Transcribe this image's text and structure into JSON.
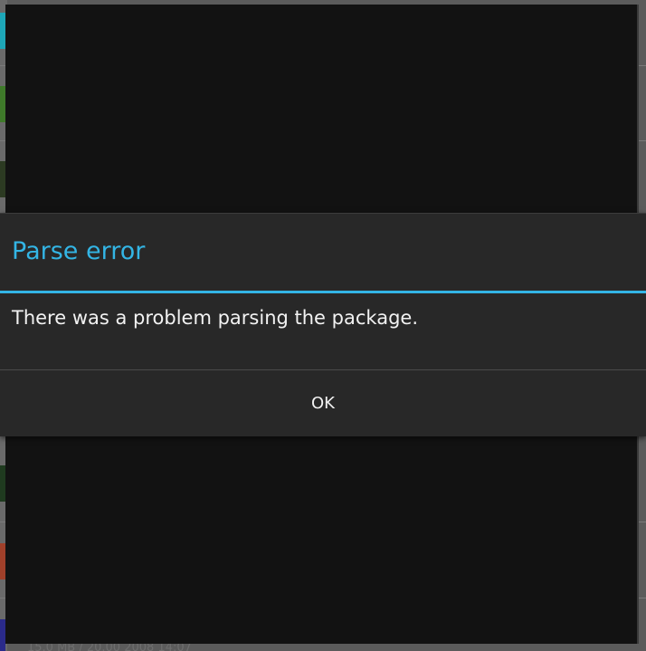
{
  "dialog": {
    "title": "Parse error",
    "message": "There was a problem parsing the package.",
    "ok_label": "OK"
  },
  "background": {
    "footer_text": "15.0 MB / 20.00 2008 14:07"
  },
  "colors": {
    "accent": "#33b5e5",
    "dialog_bg": "#282828",
    "panel_bg": "#121212",
    "text": "#f2f2f2"
  }
}
